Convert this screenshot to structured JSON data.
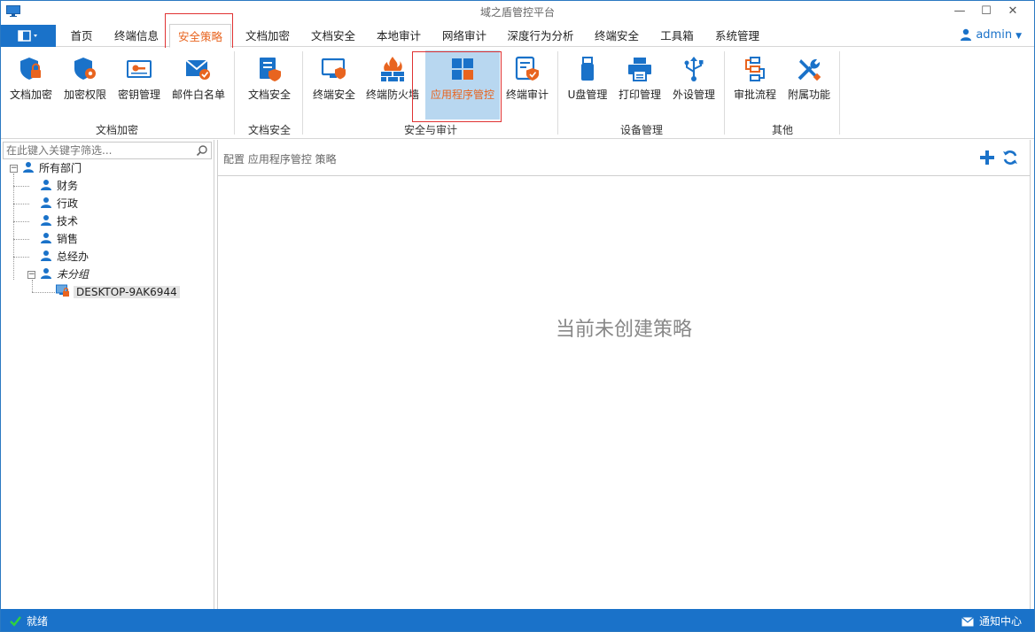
{
  "window": {
    "title": "域之盾管控平台"
  },
  "menu": {
    "tabs": [
      {
        "label": "首页"
      },
      {
        "label": "终端信息"
      },
      {
        "label": "安全策略"
      },
      {
        "label": "文档加密"
      },
      {
        "label": "文档安全"
      },
      {
        "label": "本地审计"
      },
      {
        "label": "网络审计"
      },
      {
        "label": "深度行为分析"
      },
      {
        "label": "终端安全"
      },
      {
        "label": "工具箱"
      },
      {
        "label": "系统管理"
      }
    ],
    "active_tab": "安全策略",
    "user": "admin"
  },
  "ribbon": {
    "buttons": [
      {
        "label": "文档加密",
        "icon": "shield-lock-icon"
      },
      {
        "label": "加密权限",
        "icon": "shield-gear-icon"
      },
      {
        "label": "密钥管理",
        "icon": "key-card-icon"
      },
      {
        "label": "邮件白名单",
        "icon": "mail-check-icon"
      },
      {
        "label": "文档安全",
        "icon": "document-shield-icon"
      },
      {
        "label": "终端安全",
        "icon": "monitor-shield-icon"
      },
      {
        "label": "终端防火墙",
        "icon": "firewall-icon"
      },
      {
        "label": "应用程序管控",
        "icon": "app-grid-icon"
      },
      {
        "label": "终端审计",
        "icon": "audit-check-icon"
      },
      {
        "label": "U盘管理",
        "icon": "usb-drive-icon"
      },
      {
        "label": "打印管理",
        "icon": "printer-icon"
      },
      {
        "label": "外设管理",
        "icon": "usb-symbol-icon"
      },
      {
        "label": "审批流程",
        "icon": "workflow-icon"
      },
      {
        "label": "附属功能",
        "icon": "tools-icon"
      }
    ],
    "groups": [
      {
        "label": "文档加密"
      },
      {
        "label": "文档安全"
      },
      {
        "label": "安全与审计"
      },
      {
        "label": "设备管理"
      },
      {
        "label": "其他"
      }
    ],
    "selected_button": "应用程序管控"
  },
  "sidebar": {
    "search_placeholder": "在此键入关键字筛选...",
    "tree": {
      "root": "所有部门",
      "departments": [
        {
          "label": "财务"
        },
        {
          "label": "行政"
        },
        {
          "label": "技术"
        },
        {
          "label": "销售"
        },
        {
          "label": "总经办"
        },
        {
          "label": "未分组"
        }
      ],
      "computer": "DESKTOP-9AK6944"
    }
  },
  "main": {
    "breadcrumb": "配置 应用程序管控 策略",
    "empty_message": "当前未创建策略"
  },
  "status": {
    "left": "就绪",
    "right": "通知中心"
  },
  "colors": {
    "accent_blue": "#1a72c9",
    "accent_orange": "#e8641f",
    "highlight_red": "#e03232",
    "selected_bg": "#b8d7f0"
  }
}
